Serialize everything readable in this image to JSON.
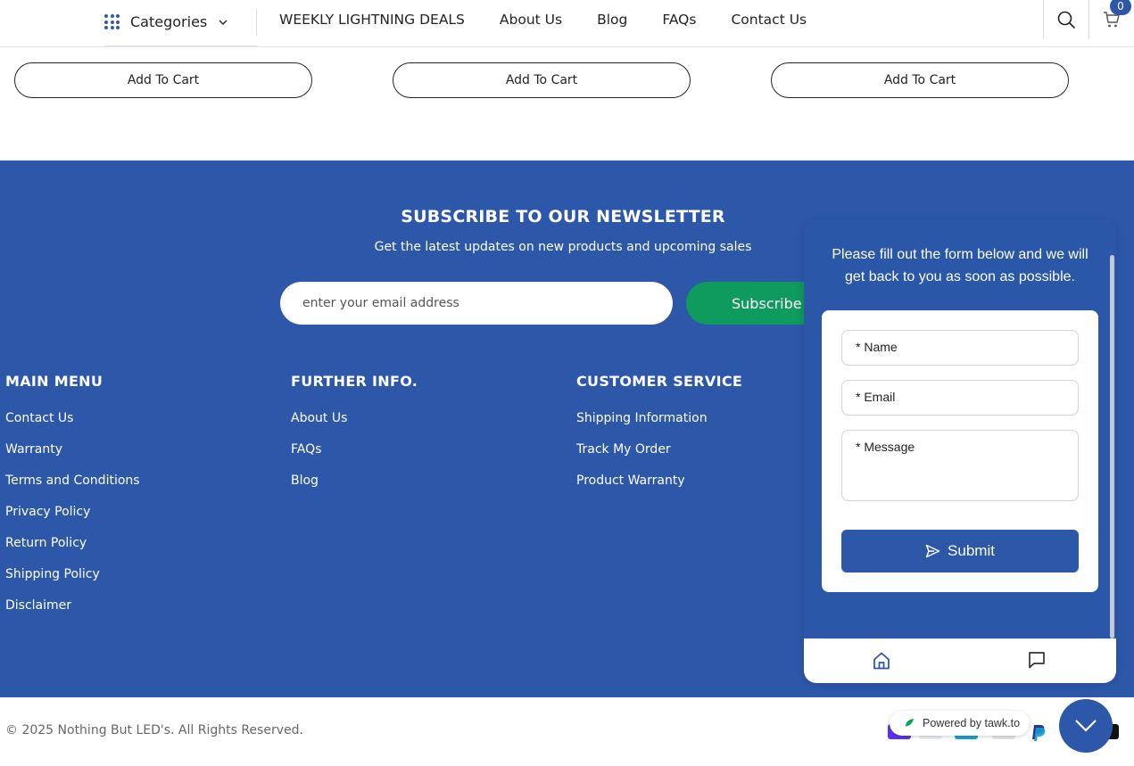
{
  "header": {
    "categories_label": "Categories",
    "nav": [
      "WEEKLY LIGHTNING DEALS",
      "About Us",
      "Blog",
      "FAQs",
      "Contact Us"
    ],
    "cart_count": "0"
  },
  "products": {
    "add_to_cart_label": "Add To Cart"
  },
  "newsletter": {
    "title": "SUBSCRIBE TO OUR NEWSLETTER",
    "subtitle": "Get the latest updates on new products and upcoming sales",
    "email_placeholder": "enter your email address",
    "subscribe_label": "Subscribe"
  },
  "footer": {
    "main_menu": {
      "title": "MAIN MENU",
      "items": [
        "Contact Us",
        "Warranty",
        "Terms and Conditions",
        "Privacy Policy",
        "Return Policy",
        "Shipping Policy",
        "Disclaimer"
      ]
    },
    "further_info": {
      "title": "FURTHER INFO.",
      "items": [
        "About Us",
        "FAQs",
        "Blog"
      ]
    },
    "customer_service": {
      "title": "CUSTOMER SERVICE",
      "items": [
        "Shipping Information",
        "Track My Order",
        "Product Warranty"
      ]
    },
    "copyright": "© 2025 Nothing But LED's. All Rights Reserved."
  },
  "chat": {
    "message": "Please fill out the form below and we will get back to you as soon as possible.",
    "name_label": "* Name",
    "email_label": "* Email",
    "message_label": "* Message",
    "submit_label": "Submit",
    "powered_by": "Powered by tawk.to"
  },
  "colors": {
    "brand_blue": "#2d58aa",
    "subscribe_green": "#0f9a5e"
  }
}
